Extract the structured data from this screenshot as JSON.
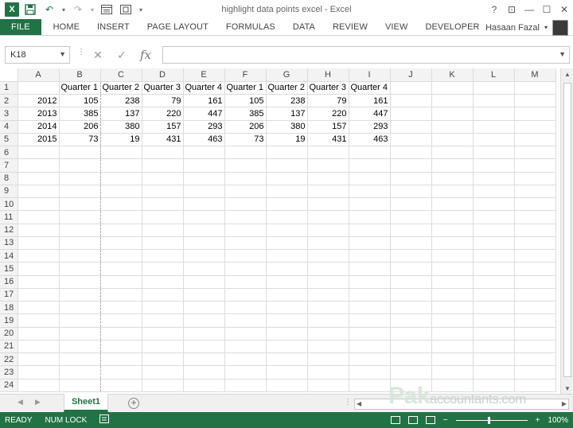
{
  "window": {
    "title": "highlight data points excel - Excel",
    "controls": [
      "?",
      "⊡",
      "—",
      "☐",
      "✕"
    ]
  },
  "qat": {
    "logo": "X",
    "undo_icon": "↶",
    "redo_icon": "↷"
  },
  "ribbon": {
    "tabs": [
      "FILE",
      "HOME",
      "INSERT",
      "PAGE LAYOUT",
      "FORMULAS",
      "DATA",
      "REVIEW",
      "VIEW",
      "DEVELOPER"
    ],
    "user_name": "Hasaan Fazal"
  },
  "formula_bar": {
    "name_box": "K18",
    "cancel_icon": "✕",
    "enter_icon": "✓",
    "fx_label": "fx",
    "formula": ""
  },
  "grid": {
    "columns": [
      "A",
      "B",
      "C",
      "D",
      "E",
      "F",
      "G",
      "H",
      "I",
      "J",
      "K",
      "L",
      "M"
    ],
    "rows": [
      [
        "",
        "Quarter 1",
        "Quarter 2",
        "Quarter 3",
        "Quarter 4",
        "Quarter 1",
        "Quarter 2",
        "Quarter 3",
        "Quarter 4",
        "",
        "",
        "",
        ""
      ],
      [
        "2012",
        "105",
        "238",
        "79",
        "161",
        "105",
        "238",
        "79",
        "161",
        "",
        "",
        "",
        ""
      ],
      [
        "2013",
        "385",
        "137",
        "220",
        "447",
        "385",
        "137",
        "220",
        "447",
        "",
        "",
        "",
        ""
      ],
      [
        "2014",
        "206",
        "380",
        "157",
        "293",
        "206",
        "380",
        "157",
        "293",
        "",
        "",
        "",
        ""
      ],
      [
        "2015",
        "73",
        "19",
        "431",
        "463",
        "73",
        "19",
        "431",
        "463",
        "",
        "",
        "",
        ""
      ]
    ],
    "row_count": 24
  },
  "sheets": {
    "active": "Sheet1",
    "add_icon": "+"
  },
  "watermark": {
    "brand": "Pak",
    "suffix": "accountants.com"
  },
  "status_bar": {
    "ready": "READY",
    "num_lock": "NUM LOCK",
    "zoom": "100%",
    "zoom_minus": "−",
    "zoom_plus": "+"
  },
  "colors": {
    "accent": "#217346"
  }
}
